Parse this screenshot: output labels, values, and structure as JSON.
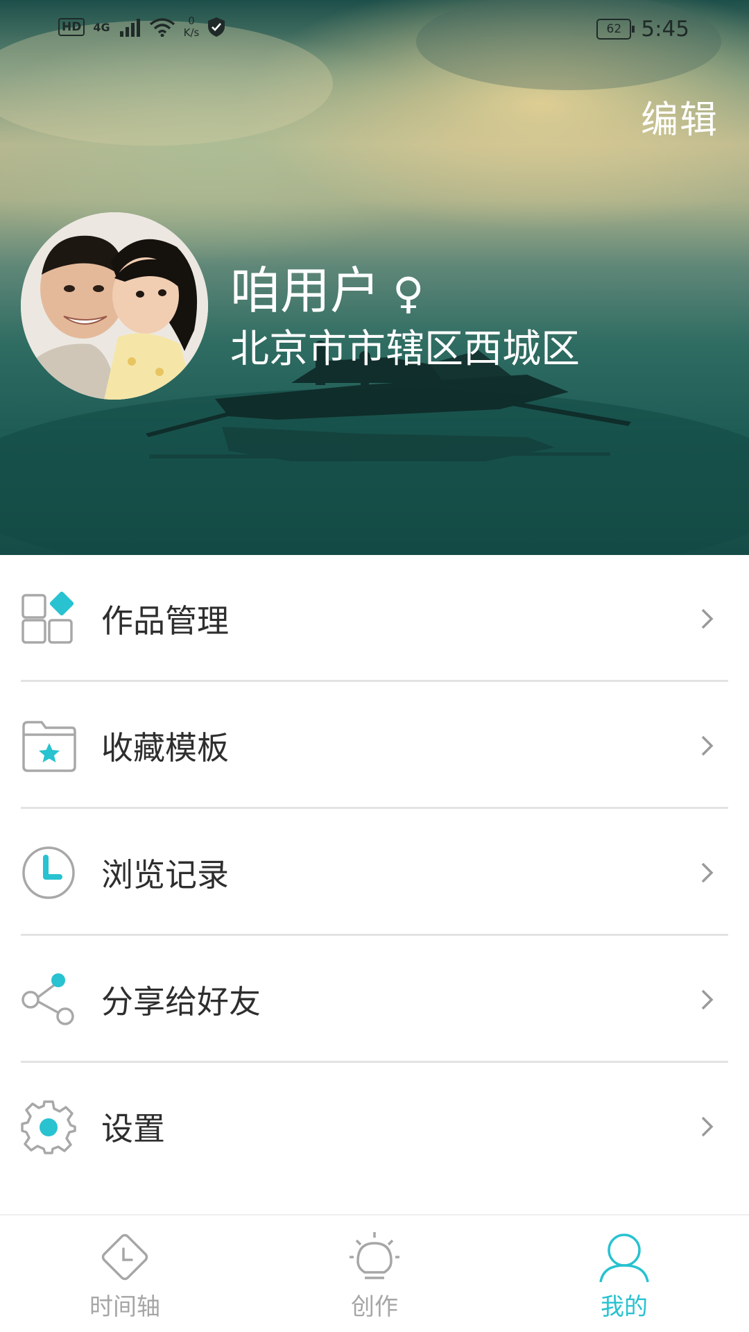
{
  "status_bar": {
    "hd": "HD",
    "network": "4G",
    "speed_value": "0",
    "speed_unit": "K/s",
    "battery": "62",
    "time": "5:45"
  },
  "header": {
    "edit_label": "编辑",
    "name": "咱用户",
    "gender_symbol": "♀",
    "location": "北京市市辖区西城区"
  },
  "menu": {
    "items": [
      {
        "label": "作品管理",
        "icon": "works-grid-icon"
      },
      {
        "label": "收藏模板",
        "icon": "favorite-folder-icon"
      },
      {
        "label": "浏览记录",
        "icon": "clock-icon"
      },
      {
        "label": "分享给好友",
        "icon": "share-icon"
      },
      {
        "label": "设置",
        "icon": "gear-icon"
      }
    ]
  },
  "bottom_nav": {
    "items": [
      {
        "label": "时间轴",
        "icon": "timeline-icon",
        "active": false
      },
      {
        "label": "创作",
        "icon": "create-bulb-icon",
        "active": false
      },
      {
        "label": "我的",
        "icon": "profile-icon",
        "active": true
      }
    ]
  },
  "colors": {
    "accent": "#28c2d0",
    "icon_gray": "#a8a8a8",
    "text": "#2e2e2e",
    "inactive": "#a6a6a6"
  }
}
